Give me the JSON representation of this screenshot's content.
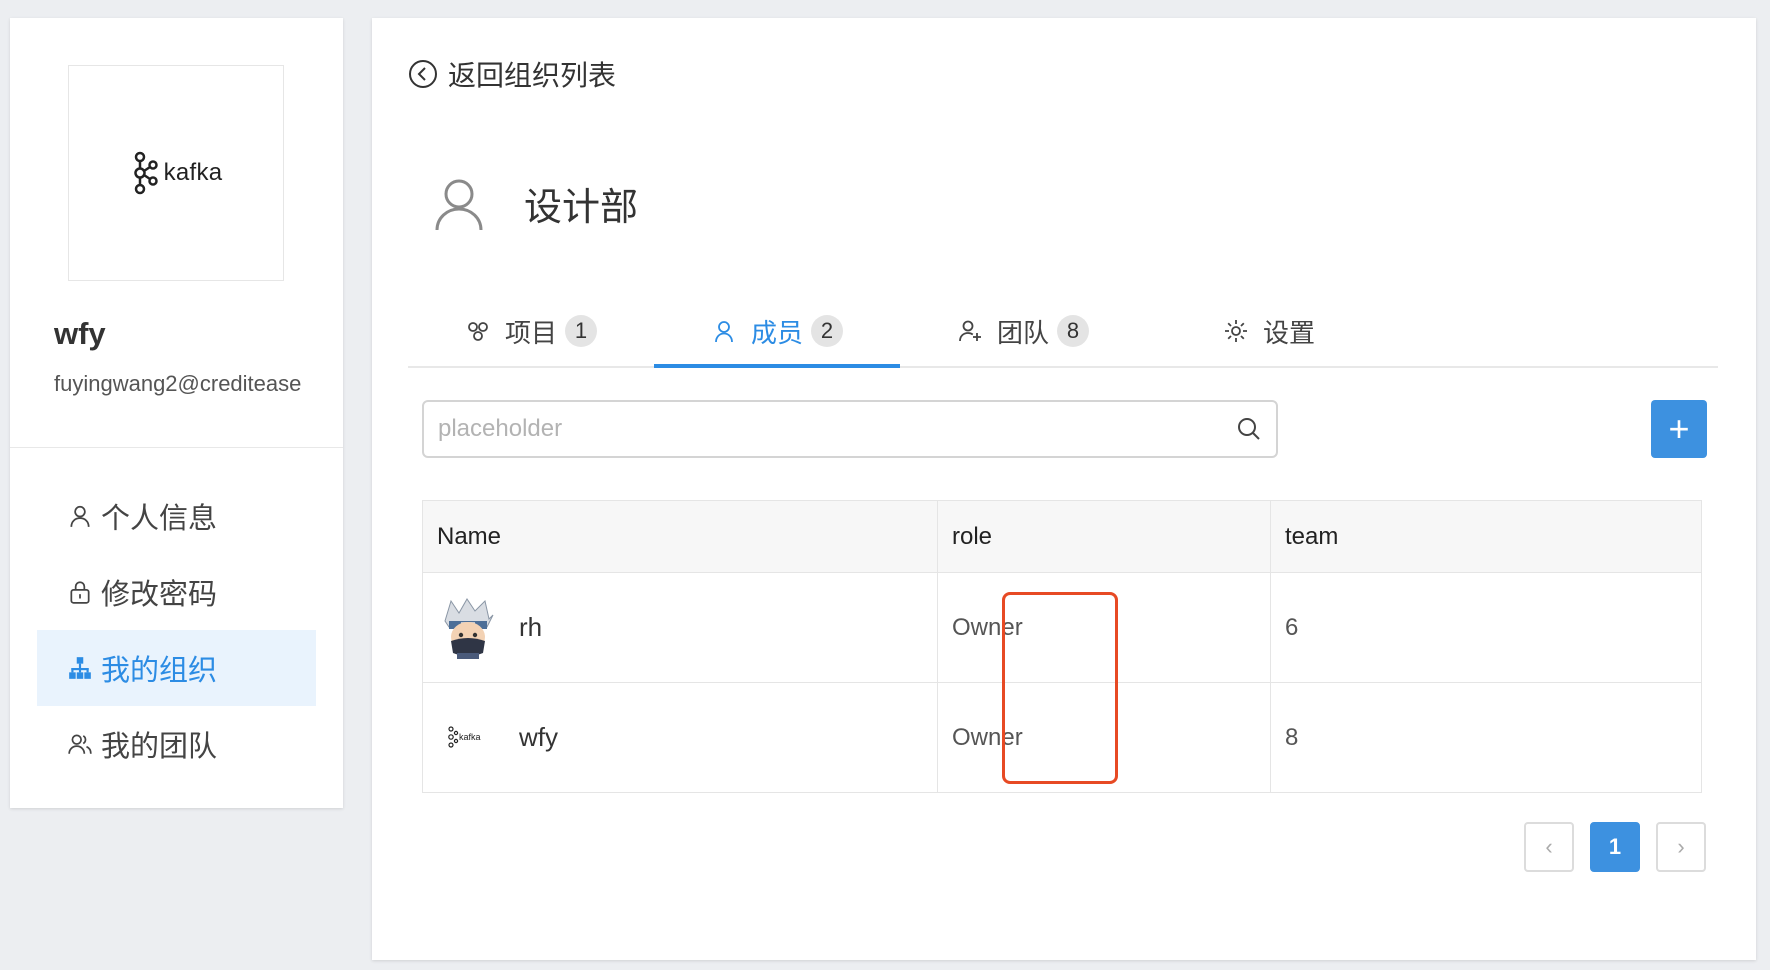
{
  "sidebar": {
    "logo_text": "kafka",
    "username": "wfy",
    "email": "fuyingwang2@creditease",
    "menu": [
      {
        "label": "个人信息",
        "icon": "user-icon",
        "active": false
      },
      {
        "label": "修改密码",
        "icon": "lock-icon",
        "active": false
      },
      {
        "label": "我的组织",
        "icon": "org-tree-icon",
        "active": true
      },
      {
        "label": "我的团队",
        "icon": "team-icon",
        "active": false
      }
    ]
  },
  "main": {
    "back_label": "返回组织列表",
    "org_name": "设计部",
    "tabs": [
      {
        "label": "项目",
        "count": "1",
        "icon": "project-icon",
        "active": false
      },
      {
        "label": "成员",
        "count": "2",
        "icon": "user-icon",
        "active": true
      },
      {
        "label": "团队",
        "count": "8",
        "icon": "add-user-icon",
        "active": false
      },
      {
        "label": "设置",
        "count": "",
        "icon": "gear-icon",
        "active": false
      }
    ],
    "search": {
      "placeholder": "placeholder",
      "value": ""
    },
    "add_label": "+",
    "table": {
      "columns": [
        "Name",
        "role",
        "team"
      ],
      "rows": [
        {
          "name": "rh",
          "avatar": "ninja-avatar",
          "role": "Owner",
          "team": "6"
        },
        {
          "name": "wfy",
          "avatar": "kafka-logo-avatar",
          "role": "Owner",
          "team": "8"
        }
      ]
    },
    "pagination": {
      "prev": "‹",
      "current": "1",
      "next": "›"
    }
  },
  "colors": {
    "accent": "#2c8ce4",
    "highlight_box": "#e74a24",
    "active_menu_bg": "#e9f3fd"
  }
}
